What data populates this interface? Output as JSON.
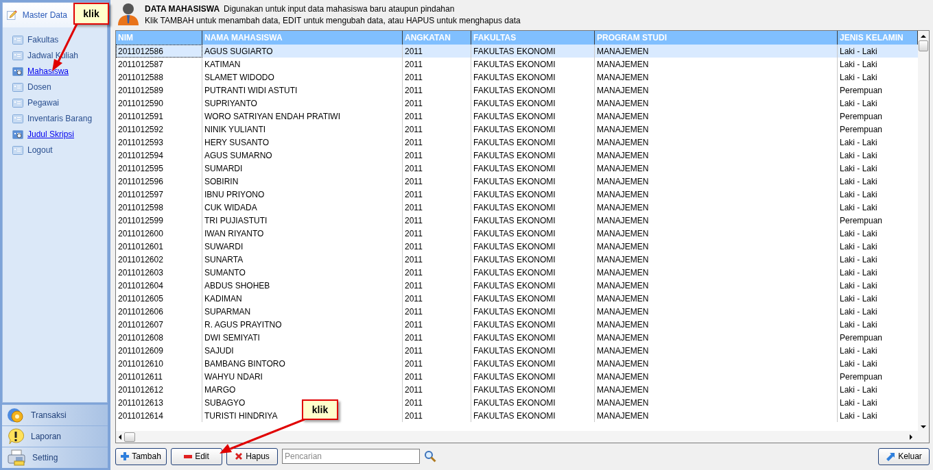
{
  "sidebar": {
    "header": "Master Data",
    "items": [
      {
        "label": "Fakultas",
        "kind": "item"
      },
      {
        "label": "Jadwal Kuliah",
        "kind": "item"
      },
      {
        "label": "Mahasiswa",
        "kind": "link"
      },
      {
        "label": "Dosen",
        "kind": "item"
      },
      {
        "label": "Pegawai",
        "kind": "item"
      },
      {
        "label": "Inventaris Barang",
        "kind": "item"
      },
      {
        "label": "Judul Skripsi",
        "kind": "link"
      },
      {
        "label": "Logout",
        "kind": "item"
      }
    ],
    "sections": [
      {
        "label": "Transaksi",
        "kind": "gear"
      },
      {
        "label": "Laporan",
        "kind": "alert"
      },
      {
        "label": "Setting",
        "kind": "fax"
      }
    ]
  },
  "header": {
    "title": "DATA MAHASISWA",
    "subtitle": "Digunakan untuk input data mahasiswa baru ataupun pindahan",
    "hint": "Klik TAMBAH untuk menambah data, EDIT untuk mengubah data, atau HAPUS untuk menghapus data"
  },
  "table": {
    "columns": [
      "NIM",
      "NAMA MAHASISWA",
      "ANGKATAN",
      "FAKULTAS",
      "PROGRAM STUDI",
      "JENIS KELAMIN"
    ],
    "rows": [
      {
        "selected": true,
        "cells": [
          "2011012586",
          "AGUS SUGIARTO",
          "2011",
          "FAKULTAS EKONOMI",
          "MANAJEMEN",
          "Laki - Laki"
        ]
      },
      {
        "selected": false,
        "cells": [
          "2011012587",
          "KATIMAN",
          "2011",
          "FAKULTAS EKONOMI",
          "MANAJEMEN",
          "Laki - Laki"
        ]
      },
      {
        "selected": false,
        "cells": [
          "2011012588",
          "SLAMET WIDODO",
          "2011",
          "FAKULTAS EKONOMI",
          "MANAJEMEN",
          "Laki - Laki"
        ]
      },
      {
        "selected": false,
        "cells": [
          "2011012589",
          "PUTRANTI WIDI ASTUTI",
          "2011",
          "FAKULTAS EKONOMI",
          "MANAJEMEN",
          "Perempuan"
        ]
      },
      {
        "selected": false,
        "cells": [
          "2011012590",
          "SUPRIYANTO",
          "2011",
          "FAKULTAS EKONOMI",
          "MANAJEMEN",
          "Laki - Laki"
        ]
      },
      {
        "selected": false,
        "cells": [
          "2011012591",
          "WORO SATRIYAN ENDAH PRATIWI",
          "2011",
          "FAKULTAS EKONOMI",
          "MANAJEMEN",
          "Perempuan"
        ]
      },
      {
        "selected": false,
        "cells": [
          "2011012592",
          "NINIK YULIANTI",
          "2011",
          "FAKULTAS EKONOMI",
          "MANAJEMEN",
          "Perempuan"
        ]
      },
      {
        "selected": false,
        "cells": [
          "2011012593",
          "HERY SUSANTO",
          "2011",
          "FAKULTAS EKONOMI",
          "MANAJEMEN",
          "Laki - Laki"
        ]
      },
      {
        "selected": false,
        "cells": [
          "2011012594",
          "AGUS SUMARNO",
          "2011",
          "FAKULTAS EKONOMI",
          "MANAJEMEN",
          "Laki - Laki"
        ]
      },
      {
        "selected": false,
        "cells": [
          "2011012595",
          "SUMARDI",
          "2011",
          "FAKULTAS EKONOMI",
          "MANAJEMEN",
          "Laki - Laki"
        ]
      },
      {
        "selected": false,
        "cells": [
          "2011012596",
          "SOBIRIN",
          "2011",
          "FAKULTAS EKONOMI",
          "MANAJEMEN",
          "Laki - Laki"
        ]
      },
      {
        "selected": false,
        "cells": [
          "2011012597",
          "IBNU PRIYONO",
          "2011",
          "FAKULTAS EKONOMI",
          "MANAJEMEN",
          "Laki - Laki"
        ]
      },
      {
        "selected": false,
        "cells": [
          "2011012598",
          "CUK WIDADA",
          "2011",
          "FAKULTAS EKONOMI",
          "MANAJEMEN",
          "Laki - Laki"
        ]
      },
      {
        "selected": false,
        "cells": [
          "2011012599",
          "TRI PUJIASTUTI",
          "2011",
          "FAKULTAS EKONOMI",
          "MANAJEMEN",
          "Perempuan"
        ]
      },
      {
        "selected": false,
        "cells": [
          "2011012600",
          "IWAN RIYANTO",
          "2011",
          "FAKULTAS EKONOMI",
          "MANAJEMEN",
          "Laki - Laki"
        ]
      },
      {
        "selected": false,
        "cells": [
          "2011012601",
          "SUWARDI",
          "2011",
          "FAKULTAS EKONOMI",
          "MANAJEMEN",
          "Laki - Laki"
        ]
      },
      {
        "selected": false,
        "cells": [
          "2011012602",
          "SUNARTA",
          "2011",
          "FAKULTAS EKONOMI",
          "MANAJEMEN",
          "Laki - Laki"
        ]
      },
      {
        "selected": false,
        "cells": [
          "2011012603",
          "SUMANTO",
          "2011",
          "FAKULTAS EKONOMI",
          "MANAJEMEN",
          "Laki - Laki"
        ]
      },
      {
        "selected": false,
        "cells": [
          "2011012604",
          "ABDUS SHOHEB",
          "2011",
          "FAKULTAS EKONOMI",
          "MANAJEMEN",
          "Laki - Laki"
        ]
      },
      {
        "selected": false,
        "cells": [
          "2011012605",
          "KADIMAN",
          "2011",
          "FAKULTAS EKONOMI",
          "MANAJEMEN",
          "Laki - Laki"
        ]
      },
      {
        "selected": false,
        "cells": [
          "2011012606",
          "SUPARMAN",
          "2011",
          "FAKULTAS EKONOMI",
          "MANAJEMEN",
          "Laki - Laki"
        ]
      },
      {
        "selected": false,
        "cells": [
          "2011012607",
          "R. AGUS PRAYITNO",
          "2011",
          "FAKULTAS EKONOMI",
          "MANAJEMEN",
          "Laki - Laki"
        ]
      },
      {
        "selected": false,
        "cells": [
          "2011012608",
          "DWI SEMIYATI",
          "2011",
          "FAKULTAS EKONOMI",
          "MANAJEMEN",
          "Perempuan"
        ]
      },
      {
        "selected": false,
        "cells": [
          "2011012609",
          "SAJUDI",
          "2011",
          "FAKULTAS EKONOMI",
          "MANAJEMEN",
          "Laki - Laki"
        ]
      },
      {
        "selected": false,
        "cells": [
          "2011012610",
          "BAMBANG BINTORO",
          "2011",
          "FAKULTAS EKONOMI",
          "MANAJEMEN",
          "Laki - Laki"
        ]
      },
      {
        "selected": false,
        "cells": [
          "2011012611",
          "WAHYU NDARI",
          "2011",
          "FAKULTAS EKONOMI",
          "MANAJEMEN",
          "Perempuan"
        ]
      },
      {
        "selected": false,
        "cells": [
          "2011012612",
          "MARGO",
          "2011",
          "FAKULTAS EKONOMI",
          "MANAJEMEN",
          "Laki - Laki"
        ]
      },
      {
        "selected": false,
        "cells": [
          "2011012613",
          "SUBAGYO",
          "2011",
          "FAKULTAS EKONOMI",
          "MANAJEMEN",
          "Laki - Laki"
        ]
      },
      {
        "selected": false,
        "cells": [
          "2011012614",
          "TURISTI HINDRIYA",
          "2011",
          "FAKULTAS EKONOMI",
          "MANAJEMEN",
          "Laki - Laki"
        ]
      }
    ]
  },
  "toolbar": {
    "add": "Tambah",
    "edit": "Edit",
    "delete": "Hapus",
    "search": {
      "placeholder": "Pencarian"
    },
    "exit": "Keluar"
  },
  "callouts": [
    {
      "text": "klik"
    },
    {
      "text": "klik"
    }
  ]
}
